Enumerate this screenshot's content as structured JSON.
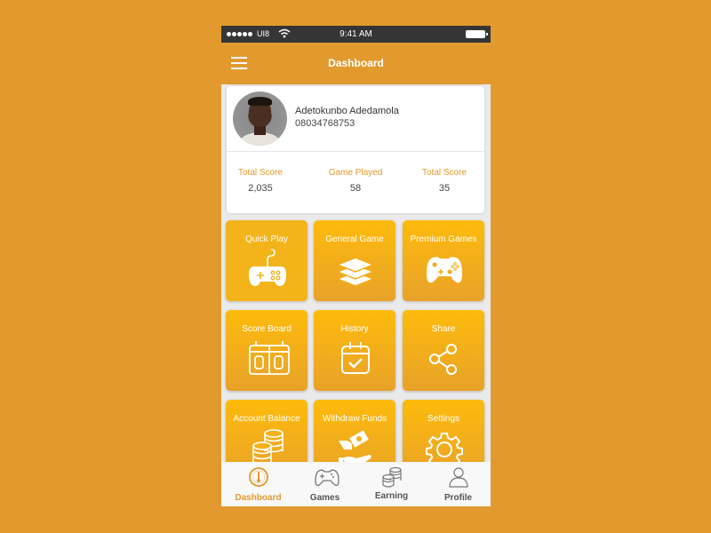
{
  "status_bar": {
    "carrier": "UI8",
    "time": "9:41 AM",
    "signal_dots": 5
  },
  "header": {
    "title": "Dashboard",
    "menu_icon": "hamburger-menu-icon"
  },
  "profile": {
    "name": "Adetokunbo Adedamola",
    "phone": "08034768753",
    "stats": [
      {
        "label": "Total Score",
        "value": "2,035"
      },
      {
        "label": "Game Played",
        "value": "58"
      },
      {
        "label": "Total Score",
        "value": "35"
      }
    ]
  },
  "tiles": [
    {
      "label": "Quick Play",
      "icon": "gamepad-corded-icon"
    },
    {
      "label": "General Game",
      "icon": "layers-icon"
    },
    {
      "label": "Premium Games",
      "icon": "gamepad-icon"
    },
    {
      "label": "Score Board",
      "icon": "scoreboard-icon"
    },
    {
      "label": "History",
      "icon": "calendar-check-icon"
    },
    {
      "label": "Share",
      "icon": "share-icon"
    },
    {
      "label": "Account Balance",
      "icon": "coins-icon"
    },
    {
      "label": "Withdraw Funds",
      "icon": "cash-hand-icon"
    },
    {
      "label": "Settings",
      "icon": "gear-icon"
    }
  ],
  "tabbar": {
    "active": "Dashboard",
    "items": [
      {
        "label": "Dashboard",
        "icon": "speedometer-icon"
      },
      {
        "label": "Games",
        "icon": "gamepad-icon"
      },
      {
        "label": "Earning",
        "icon": "coins-icon"
      },
      {
        "label": "Profile",
        "icon": "user-icon"
      }
    ]
  },
  "colors": {
    "accent": "#E29A2E",
    "tile_top": "#FDBB0B",
    "tile_bottom": "#E8A22A",
    "status_bar": "#353535"
  }
}
